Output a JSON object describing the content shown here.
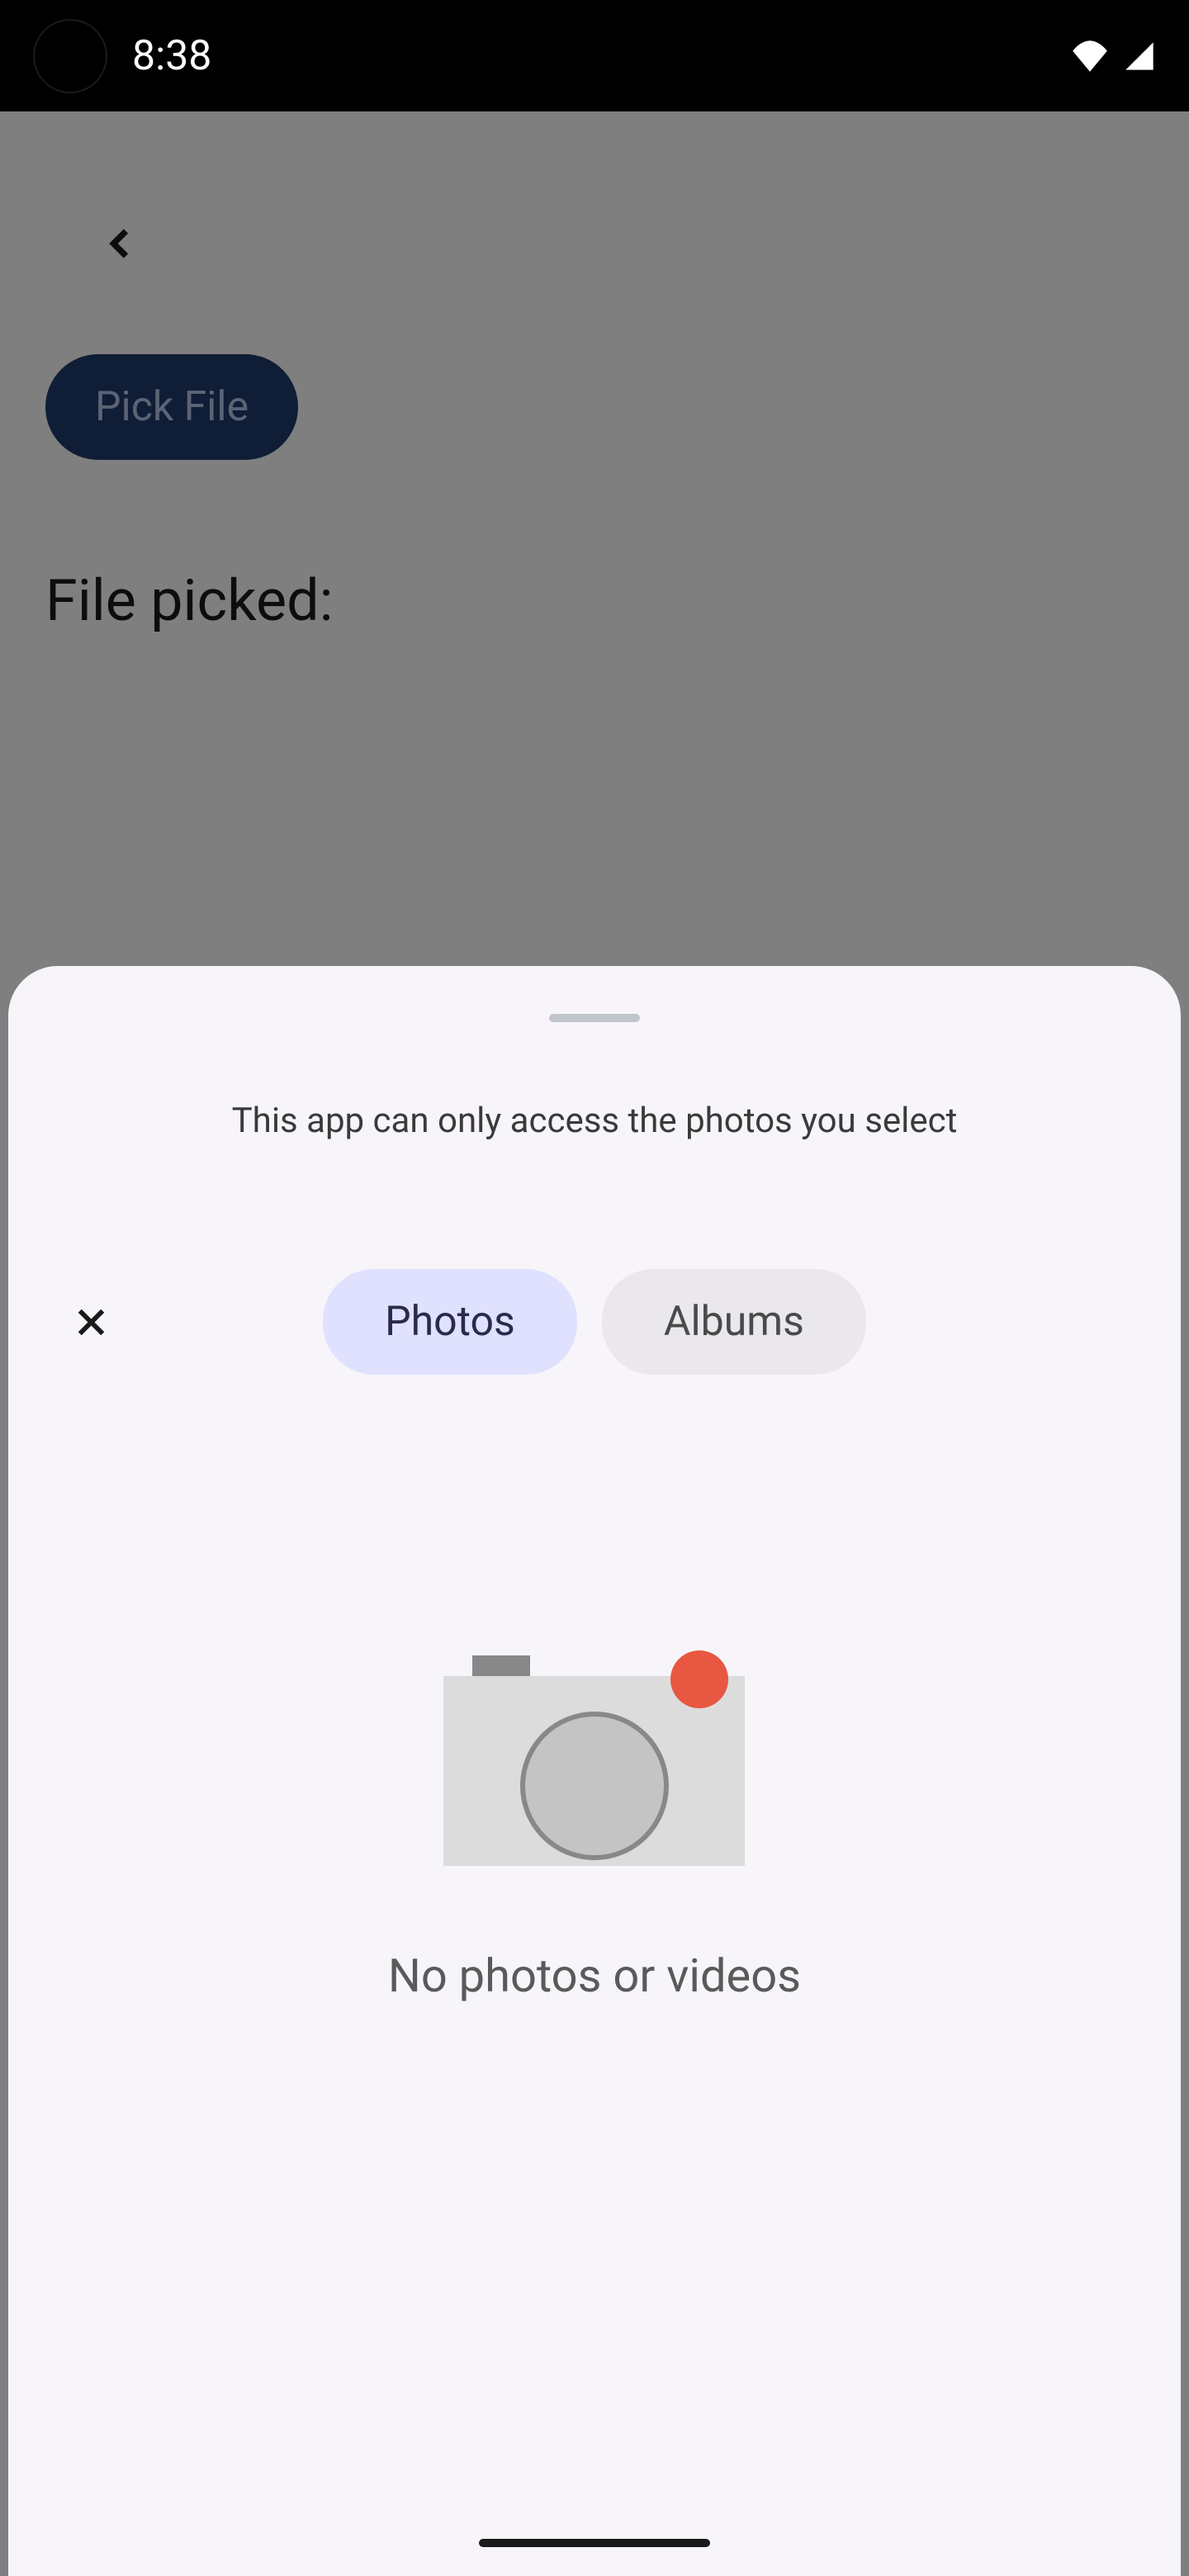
{
  "status_bar": {
    "time": "8:38"
  },
  "background": {
    "pick_file_label": "Pick File",
    "file_picked_label": "File picked:"
  },
  "sheet": {
    "access_message": "This app can only access the photos you select",
    "tabs": {
      "photos": "Photos",
      "albums": "Albums"
    },
    "empty_state": {
      "message": "No photos or videos"
    }
  }
}
